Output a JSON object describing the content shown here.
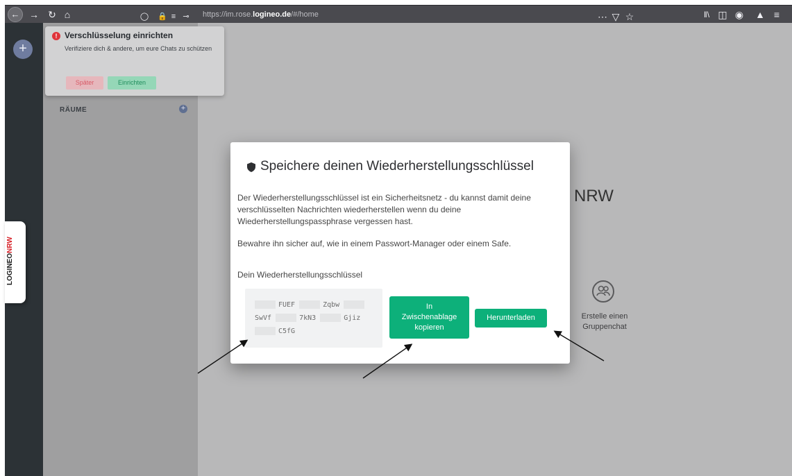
{
  "browser": {
    "url_prefix": "https://im.rose.",
    "url_domain": "logineo.de",
    "url_suffix": "/#/home",
    "icons": [
      "back-icon",
      "forward-icon",
      "reload-icon",
      "home-icon",
      "shield-icon",
      "lock-icon",
      "permissions-icon",
      "key-icon",
      "more-icon",
      "pocket-icon",
      "star-icon",
      "library-icon",
      "sidebar-icon",
      "account-icon",
      "extensions-icon",
      "menu-icon"
    ]
  },
  "toast": {
    "title": "Verschlüsselung einrichten",
    "body": "Verifiziere dich & andere, um eure Chats zu schützen",
    "later_label": "Später",
    "setup_label": "Einrichten"
  },
  "sidebar": {
    "rooms_label": "RÄUME"
  },
  "side_tab": {
    "brand_a": "LOGINEO",
    "brand_b": "NRW"
  },
  "main": {
    "welcome_fragment": "o NRW",
    "group_label": "Erstelle einen Gruppenchat"
  },
  "dialog": {
    "title": "Speichere deinen Wiederherstellungsschlüssel",
    "paragraph1": "Der Wiederherstellungsschlüssel ist ein Sicherheitsnetz - du kannst damit deine verschlüsselten Nachrichten wiederherstellen wenn du deine Wiederherstellungspassphrase vergessen hast.",
    "paragraph2": "Bewahre ihn sicher auf, wie in einem Passwort-Manager oder einem Safe.",
    "key_label": "Dein Wiederherstellungsschlüssel",
    "key_parts": [
      "FUEF",
      "Zqbw",
      "SwVf",
      "7kN3",
      "Gjiz",
      "C5fG"
    ],
    "copy_label_line1": "In",
    "copy_label_line2": "Zwischenablage",
    "copy_label_line3": "kopieren",
    "download_label": "Herunterladen"
  }
}
